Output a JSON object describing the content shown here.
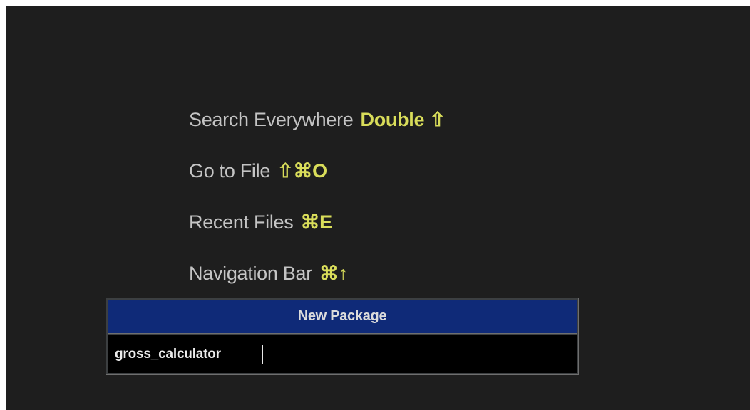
{
  "shortcut_hints": [
    {
      "label": "Search Everywhere",
      "shortcut": "Double ⇧"
    },
    {
      "label": "Go to File",
      "shortcut": "⇧⌘O"
    },
    {
      "label": "Recent Files",
      "shortcut": "⌘E"
    },
    {
      "label": "Navigation Bar",
      "shortcut": "⌘↑"
    }
  ],
  "new_package_dialog": {
    "title": "New Package",
    "input_value": "gross_calculator"
  },
  "colors": {
    "background": "#1e1e1e",
    "hint_text": "#c4c4c4",
    "shortcut_text": "#d9dd5a",
    "dialog_title_bar": "#0f2a78",
    "input_background": "#000000"
  }
}
